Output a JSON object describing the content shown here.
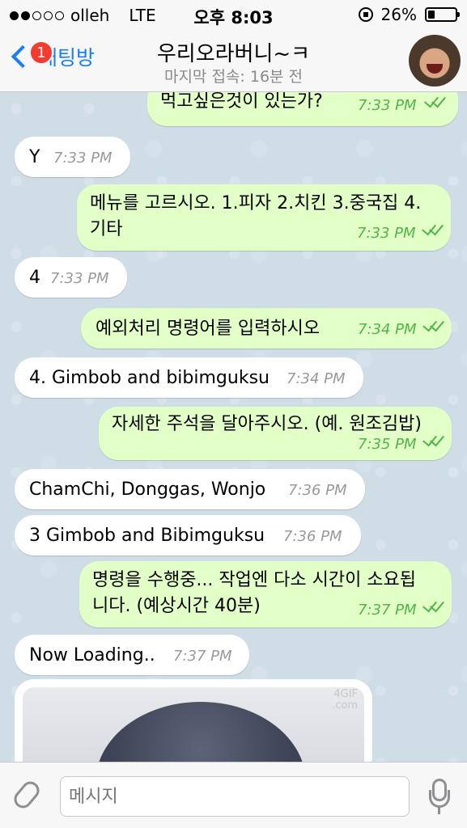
{
  "status_bar": {
    "carrier": "olleh",
    "network": "LTE",
    "time": "오후 8:03",
    "battery": "26%",
    "battery_level": 0.26
  },
  "nav": {
    "back_label": "채팅방",
    "badge_count": "1",
    "title": "우리오라버니~ㅋ",
    "subtitle": "마지막 접속: 16분 전"
  },
  "messages": [
    {
      "dir": "out",
      "text": "먹고싶은것이 있는가?",
      "time": "7:33 PM"
    },
    {
      "dir": "in",
      "text": "Y",
      "time": "7:33 PM"
    },
    {
      "dir": "out",
      "text_line1": "메뉴를 고르시오. 1.피자 2.치킨 3.중국집 4.",
      "text_line2": "기타",
      "time": "7:33 PM"
    },
    {
      "dir": "in",
      "text": "4",
      "time": "7:33 PM"
    },
    {
      "dir": "out",
      "text": "예외처리 명령어를 입력하시오",
      "time": "7:34 PM"
    },
    {
      "dir": "in",
      "text": "4. Gimbob and bibimguksu",
      "time": "7:34 PM"
    },
    {
      "dir": "out",
      "text": "자세한 주석을 달아주시오. (예. 원조김밥)",
      "time": "7:35 PM"
    },
    {
      "dir": "in",
      "text": "ChamChi, Donggas, Wonjo",
      "time": "7:36 PM"
    },
    {
      "dir": "in",
      "text": "3 Gimbob and Bibimguksu",
      "time": "7:36 PM"
    },
    {
      "dir": "out",
      "text_line1": "명령을 수행중... 작업엔 다소 시간이 소요됩",
      "text_line2": "니다. (예상시간 40분)",
      "time": "7:37 PM"
    },
    {
      "dir": "in",
      "text": "Now Loading..",
      "time": "7:37 PM"
    }
  ],
  "image_message": {
    "watermark_line1": "4GIF",
    "watermark_line2": ".com"
  },
  "input_bar": {
    "placeholder": "메시지"
  },
  "colors": {
    "accent": "#167efb",
    "outgoing_bubble": "#e2ffc7",
    "incoming_bubble": "#ffffff",
    "read_ticks": "#52b548",
    "badge": "#f43b30",
    "chat_background": "#cfdde7"
  },
  "icons": [
    "back-chevron-icon",
    "attach-paperclip-icon",
    "microphone-icon",
    "rotation-lock-icon",
    "battery-icon",
    "signal-dots-icon"
  ]
}
